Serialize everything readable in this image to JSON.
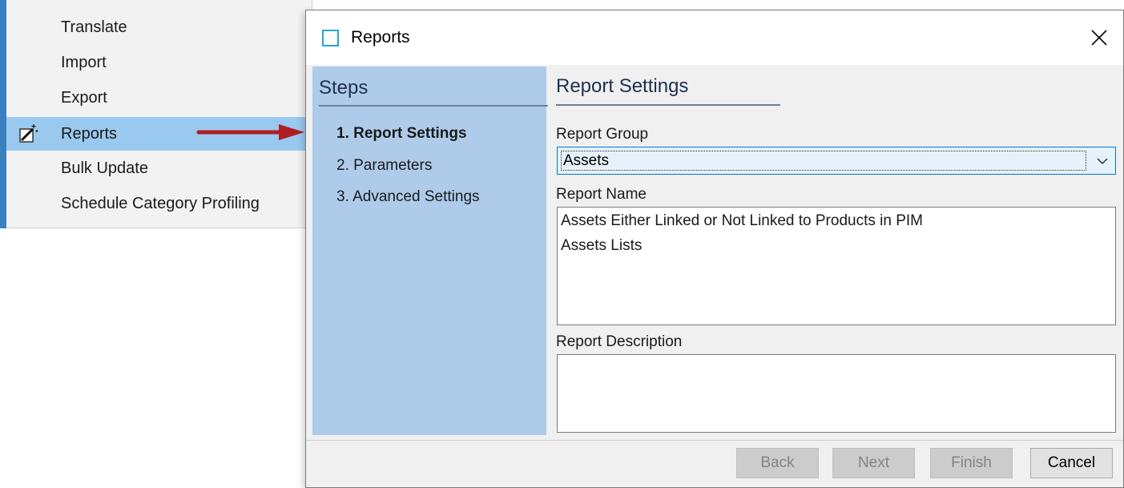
{
  "context_menu": {
    "items": [
      {
        "label": "Translate"
      },
      {
        "label": "Import"
      },
      {
        "label": "Export"
      },
      {
        "label": "Reports",
        "selected": true,
        "icon": "magic-wand-icon"
      },
      {
        "label": "Bulk Update"
      },
      {
        "label": "Schedule Category Profiling"
      }
    ],
    "highlight_color": "#99c9ef"
  },
  "annotation": {
    "icon": "red-arrow-icon",
    "color": "#b01e23"
  },
  "dialog": {
    "title": "Reports",
    "steps": {
      "header": "Steps",
      "items": [
        {
          "label": "1. Report Settings",
          "active": true
        },
        {
          "label": "2. Parameters"
        },
        {
          "label": "3. Advanced Settings"
        }
      ]
    },
    "content": {
      "header": "Report Settings",
      "report_group_label": "Report Group",
      "report_group_value": "Assets",
      "report_name_label": "Report Name",
      "report_names": [
        "Assets Either Linked or Not Linked to Products in PIM",
        "Assets Lists"
      ],
      "report_description_label": "Report Description",
      "report_description": ""
    },
    "buttons": {
      "back": "Back",
      "next": "Next",
      "finish": "Finish",
      "cancel": "Cancel"
    },
    "colors": {
      "steps_panel": "#aecbea",
      "combo_focus": "#0078d7"
    }
  }
}
